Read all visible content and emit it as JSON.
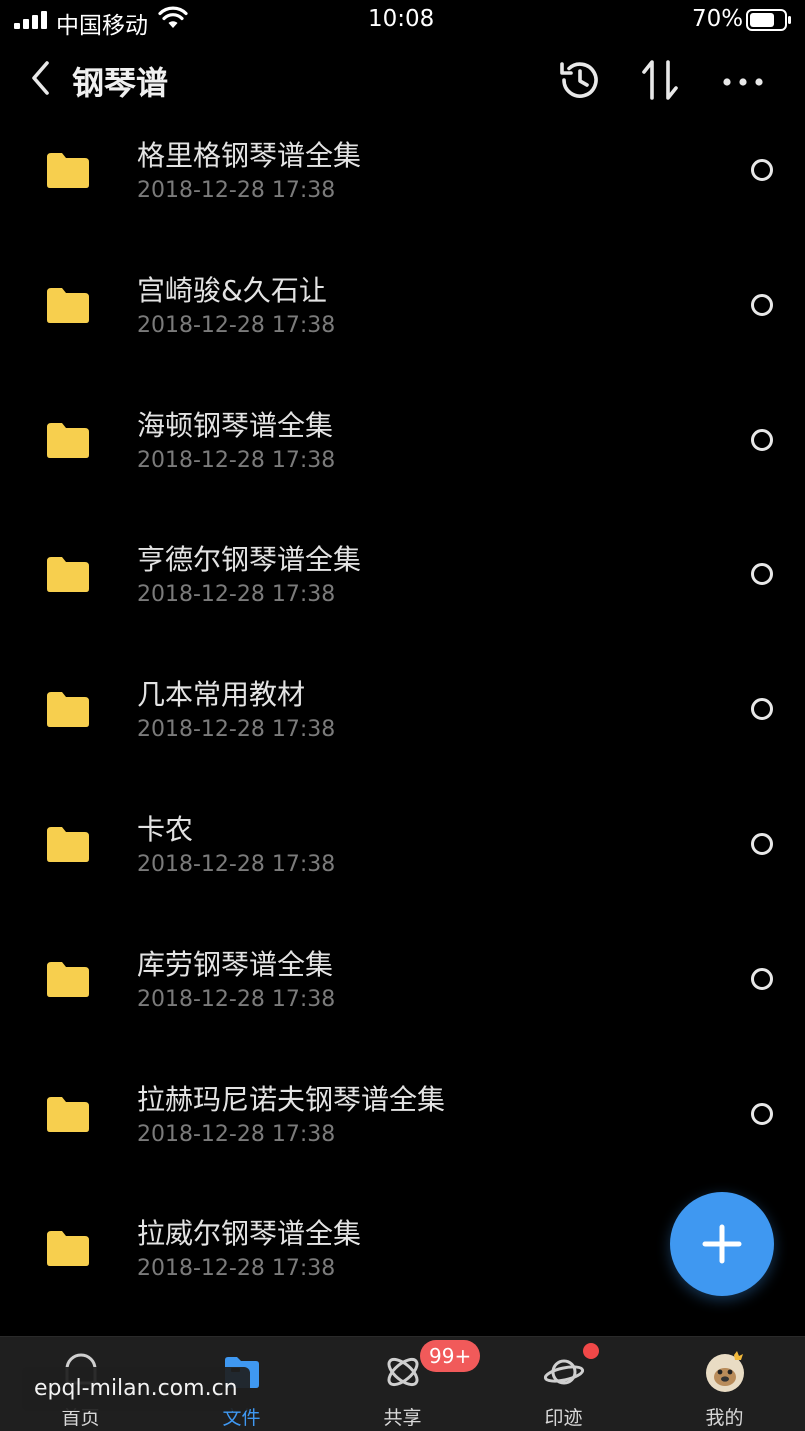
{
  "status_bar": {
    "carrier": "中国移动",
    "time": "10:08",
    "battery": "70%"
  },
  "nav": {
    "title": "钢琴谱",
    "icons": [
      "back-icon",
      "history-icon",
      "sort-icon",
      "more-icon"
    ]
  },
  "files": [
    {
      "name": "格里格钢琴谱全集",
      "date": "2018-12-28 17:38"
    },
    {
      "name": "宫崎骏&久石让",
      "date": "2018-12-28 17:38"
    },
    {
      "name": "海顿钢琴谱全集",
      "date": "2018-12-28 17:38"
    },
    {
      "name": "亨德尔钢琴谱全集",
      "date": "2018-12-28 17:38"
    },
    {
      "name": "几本常用教材",
      "date": "2018-12-28 17:38"
    },
    {
      "name": "卡农",
      "date": "2018-12-28 17:38"
    },
    {
      "name": "库劳钢琴谱全集",
      "date": "2018-12-28 17:38"
    },
    {
      "name": "拉赫玛尼诺夫钢琴谱全集",
      "date": "2018-12-28 17:38"
    },
    {
      "name": "拉威尔钢琴谱全集",
      "date": "2018-12-28 17:38"
    }
  ],
  "tabs": [
    {
      "label": "首页",
      "icon": "home-icon"
    },
    {
      "label": "文件",
      "icon": "folder-icon",
      "active": true
    },
    {
      "label": "共享",
      "icon": "share-icon",
      "badge": "99+"
    },
    {
      "label": "印迹",
      "icon": "planet-icon",
      "dot": true
    },
    {
      "label": "我的",
      "icon": "avatar-icon"
    }
  ],
  "watermark": "epql-milan.com.cn",
  "colors": {
    "accent": "#3f98f1",
    "folder": "#f7cf4e",
    "badge": "#f15a5a",
    "background": "#000000"
  }
}
